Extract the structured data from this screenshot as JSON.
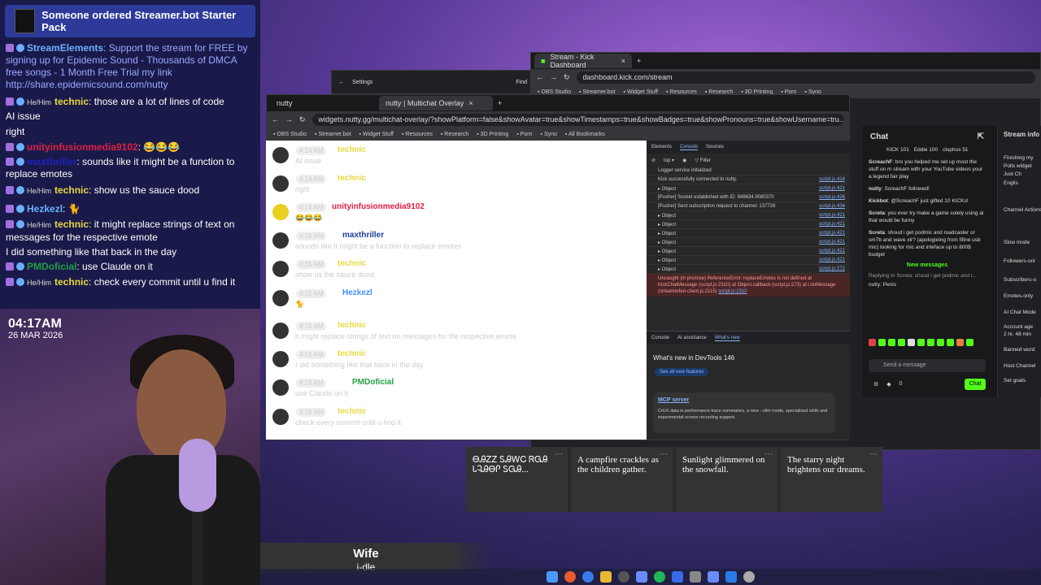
{
  "alert": {
    "text": "Someone ordered Streamer.bot Starter Pack"
  },
  "left_chat": [
    {
      "name": "StreamElements",
      "name_color": "#6ab0ff",
      "text": ": Support the stream for FREE by signing up for Epidemic Sound - Thousands of DMCA free songs - 1 Month Free Trial my link http://share.epidemicsound.com/nutty",
      "text_color": "#9aa8ff",
      "pron": ""
    },
    {
      "name": "technic",
      "name_color": "#e8d840",
      "text": ": those are a lot of lines of code",
      "text_color": "#ffffff",
      "pron": "He/Him"
    },
    {
      "name": "",
      "name_color": "#ffffff",
      "text": "AI issue",
      "text_color": "#ffffff",
      "pron": ""
    },
    {
      "name": "",
      "name_color": "#ffffff",
      "text": "right",
      "text_color": "#ffffff",
      "pron": ""
    },
    {
      "name": "unityinfusionmedia9102",
      "name_color": "#e02040",
      "text": ": 😂😂😂",
      "text_color": "#ffffff",
      "pron": ""
    },
    {
      "name": "maxthriller",
      "name_color": "#2020c0",
      "text": ": sounds like it might be a function to replace emotes",
      "text_color": "#ffffff",
      "pron": ""
    },
    {
      "name": "technic",
      "name_color": "#e8d840",
      "text": ": show us the sauce dood",
      "text_color": "#ffffff",
      "pron": "He/Him"
    },
    {
      "name": "Hezkezl",
      "name_color": "#6ab0ff",
      "text": ": 🐈",
      "text_color": "#ffffff",
      "pron": ""
    },
    {
      "name": "technic",
      "name_color": "#e8d840",
      "text": ": it might replace strings of text on messages for the respective emote",
      "text_color": "#ffffff",
      "pron": "He/Him"
    },
    {
      "name": "",
      "name_color": "#ffffff",
      "text": "I did something like that back in the day",
      "text_color": "#ffffff",
      "pron": ""
    },
    {
      "name": "PMDoficial",
      "name_color": "#20a040",
      "text": ": use Claude on it",
      "text_color": "#ffffff",
      "pron": ""
    },
    {
      "name": "technic",
      "name_color": "#e8d840",
      "text": ": check every commit until u find it",
      "text_color": "#ffffff",
      "pron": "He/Him"
    }
  ],
  "clock": {
    "time": "04:17AM",
    "date": "26 MAR 2026"
  },
  "now_playing": {
    "title": "Wife",
    "artist": "i-dle"
  },
  "settings_window": {
    "title": "Settings",
    "find": "Find"
  },
  "multichat": {
    "tabs": [
      "nutty",
      "nutty | Multichat Overlay"
    ],
    "url": "widgets.nutty.gg/multichat-overlay/?showPlatform=false&showAvatar=true&showTimestamps=true&showBadges=true&showPronouns=true&showUsername=tru...",
    "bookmarks": [
      "OBS Studio",
      "Streamer.bot",
      "Widget Stuff",
      "Resources",
      "Research",
      "3D Printing",
      "Porn",
      "Syno",
      "All Bookmarks"
    ],
    "messages": [
      {
        "time": "4:14 AM",
        "name": "technic",
        "text": "AI issue",
        "style": ""
      },
      {
        "time": "4:14 AM",
        "name": "technic",
        "text": "right",
        "style": ""
      },
      {
        "time": "4:14 AM",
        "name": "unityinfusionmedia9102",
        "text": "😂😂😂",
        "style": "red"
      },
      {
        "time": "4:15 AM",
        "name": "maxthriller",
        "text": "sounds like it might be a function to replace emotes",
        "style": "blue"
      },
      {
        "time": "4:15 AM",
        "name": "technic",
        "text": "show us the sauce dood",
        "style": ""
      },
      {
        "time": "4:15 AM",
        "name": "Hezkezl",
        "text": "🐈",
        "style": "lblue"
      },
      {
        "time": "4:15 AM",
        "name": "technic",
        "text": "it might replace strings of text on messages for the respective emote",
        "style": ""
      },
      {
        "time": "4:15 AM",
        "name": "technic",
        "text": "I did something like that back in the day",
        "style": ""
      },
      {
        "time": "4:16 AM",
        "name": "PMDoficial",
        "text": "use Claude on it",
        "style": "green"
      },
      {
        "time": "4:16 AM",
        "name": "technic",
        "text": "check every commit until u find it",
        "style": ""
      }
    ]
  },
  "devtools": {
    "tabs": [
      "Elements",
      "Console",
      "Sources"
    ],
    "lines": [
      {
        "text": "Logger service initialized",
        "src": ""
      },
      {
        "text": "Kick successfully connected to nutty.",
        "src": "script.js:414"
      },
      {
        "text": "▸ Object",
        "src": "script.js:421"
      },
      {
        "text": "[Pusher] Socket established with ID: 948634.9080370",
        "src": "script.js:426"
      },
      {
        "text": "[Pusher] Sent subscription request to channel: 137726",
        "src": "script.js:434"
      },
      {
        "text": "▸ Object",
        "src": "script.js:421"
      },
      {
        "text": "▸ Object",
        "src": "script.js:421"
      },
      {
        "text": "▸ Object",
        "src": "script.js:421"
      },
      {
        "text": "▸ Object",
        "src": "script.js:421"
      },
      {
        "text": "▸ Object",
        "src": "script.js:421"
      },
      {
        "text": "▸ Object",
        "src": "script.js:421"
      },
      {
        "text": "▸ Object",
        "src": "script.js:272"
      }
    ],
    "error": "Uncaught (in promise) ReferenceError: replaceEmotes is not defined at KickChatMessage (script.js:2310) at Object.callback (script.js:273) at l.onMessage (streamerbot-client.js:2115)",
    "error_src": "script.js:2310",
    "bottom_tabs": [
      "Console",
      "AI assistance",
      "What's new"
    ],
    "whats_new": "What's new in DevTools 146",
    "see_features": "See all new features",
    "mcp_title": "MCP server",
    "mcp_text": "CrUX data in performance trace summaries, a new --slim mode, specialized skills and experimental screen recording support."
  },
  "kick": {
    "tab": "Stream - Kick Dashboard",
    "url": "dashboard.kick.com/stream",
    "bookmarks": [
      "OBS Studio",
      "Streamer.bot",
      "Widget Stuff",
      "Resources",
      "Research",
      "3D Printing",
      "Porn",
      "Syno"
    ],
    "chat_title": "Chat",
    "top_users": [
      "KICK 101",
      "Eddie 100",
      "cluphus 51"
    ],
    "messages": [
      {
        "user": "ScreachF",
        "text": ": bro you helped me set up most the stuff on m stream with your YouTube videos your a legend fair play"
      },
      {
        "user": "nutty",
        "text": ": ScreachF followed!"
      },
      {
        "user": "Kickbot",
        "text": ": @ScreachF just gifted 10 KICKs!"
      },
      {
        "user": "Screta",
        "text": ": you ever try make a game solely using ai that would be funny"
      },
      {
        "user": "Screta",
        "text": ": shoud i get podmic and roadcaster or sm7b and wave xlr? (apologieing from fifine usb mic) looking for mic and inteface up to 800$ budget"
      }
    ],
    "new_messages": "New messages",
    "reply": "Replying to Screta: shoud i get podmic and r...",
    "reply_msg": "nutty: Penis",
    "input_placeholder": "Send a message",
    "chat_btn": "Chat",
    "count": "0",
    "side_title": "Stream info",
    "side_items": [
      "Finishing my",
      "Polls widget",
      "Just Ch",
      "Englis",
      "Channel Actions",
      "Slow mode",
      "Followers-onl",
      "Subscribers-o",
      "Emotes-only",
      "AI Chat Mode",
      "Account age",
      "2 hr, 48 min",
      "Banned word",
      "Host Channel",
      "Set goals"
    ]
  },
  "cards": [
    "ᎾᎯᏃᏃ ᏚᎯᎳᏟ ᏒᏀᎯ ᏓᎸᎯᎾᎵ ᏚᏀᎯ...",
    "A campfire crackles as the children gather.",
    "Sunlight glimmered on the snowfall.",
    "The starry night brightens our dreams."
  ]
}
